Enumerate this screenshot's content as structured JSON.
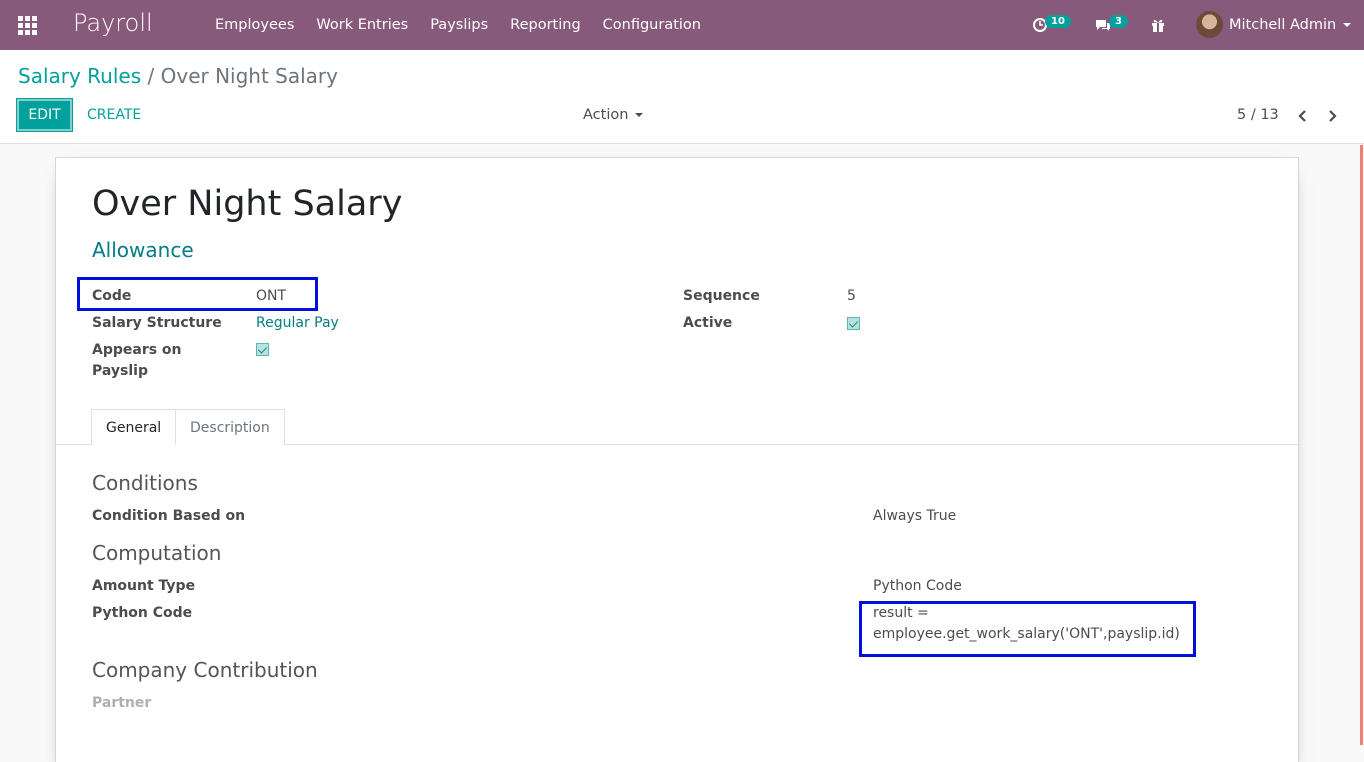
{
  "navbar": {
    "app_name": "Payroll",
    "menu": [
      "Employees",
      "Work Entries",
      "Payslips",
      "Reporting",
      "Configuration"
    ],
    "activity_count": "10",
    "message_count": "3",
    "user": "Mitchell Admin"
  },
  "breadcrumb": {
    "parent": "Salary Rules",
    "separator": "/",
    "current": "Over Night Salary"
  },
  "toolbar": {
    "edit_label": "EDIT",
    "create_label": "CREATE",
    "action_label": "Action",
    "pager": "5 / 13"
  },
  "record": {
    "name": "Over Night Salary",
    "category": "Allowance",
    "fields": {
      "code_label": "Code",
      "code_value": "ONT",
      "structure_label": "Salary Structure",
      "structure_value": "Regular Pay",
      "appears_label_1": "Appears on",
      "appears_label_2": "Payslip",
      "appears_value": true,
      "sequence_label": "Sequence",
      "sequence_value": "5",
      "active_label": "Active",
      "active_value": true
    },
    "tabs": [
      "General",
      "Description"
    ],
    "conditions": {
      "heading": "Conditions",
      "based_on_label": "Condition Based on",
      "based_on_value": "Always True"
    },
    "computation": {
      "heading": "Computation",
      "amount_type_label": "Amount Type",
      "amount_type_value": "Python Code",
      "python_code_label": "Python Code",
      "python_code_line1": "result =",
      "python_code_line2": "employee.get_work_salary('ONT',payslip.id)"
    },
    "contribution": {
      "heading": "Company Contribution",
      "partner_label": "Partner"
    }
  },
  "colors": {
    "navbar": "#875a7b",
    "accent": "#00a09d",
    "highlight_box": "#0010d8"
  }
}
